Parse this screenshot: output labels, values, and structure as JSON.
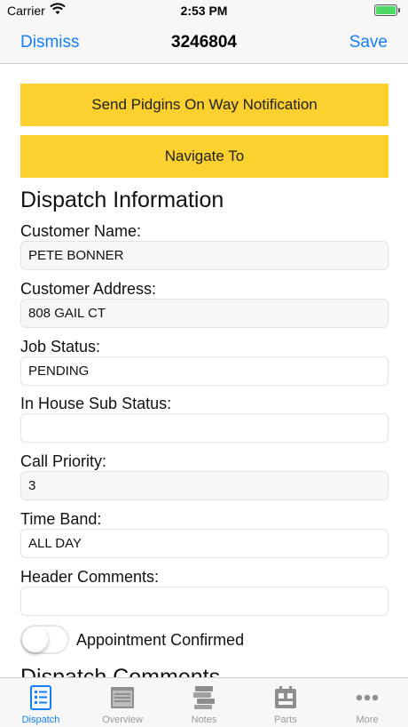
{
  "status_bar": {
    "carrier": "Carrier",
    "time": "2:53 PM",
    "battery_level": 1.0
  },
  "nav": {
    "dismiss_label": "Dismiss",
    "title": "3246804",
    "save_label": "Save"
  },
  "actions": {
    "send_notification_label": "Send Pidgins On Way Notification",
    "navigate_label": "Navigate To"
  },
  "dispatch_info": {
    "heading": "Dispatch Information",
    "fields": [
      {
        "label": "Customer Name:",
        "value": "PETE BONNER"
      },
      {
        "label": "Customer Address:",
        "value": "808 GAIL CT"
      },
      {
        "label": "Job Status:",
        "value": "PENDING"
      },
      {
        "label": "In House Sub Status:",
        "value": ""
      },
      {
        "label": "Call Priority:",
        "value": "3"
      },
      {
        "label": "Time Band:",
        "value": "ALL DAY"
      },
      {
        "label": "Header Comments:",
        "value": ""
      }
    ],
    "appointment_confirmed_label": "Appointment Confirmed",
    "appointment_confirmed": false
  },
  "dispatch_comments": {
    "heading": "Dispatch Comments"
  },
  "tabs": [
    {
      "label": "Dispatch",
      "icon": "list-document-icon",
      "active": true
    },
    {
      "label": "Overview",
      "icon": "overview-icon",
      "active": false
    },
    {
      "label": "Notes",
      "icon": "notes-icon",
      "active": false
    },
    {
      "label": "Parts",
      "icon": "parts-icon",
      "active": false
    },
    {
      "label": "More",
      "icon": "more-icon",
      "active": false
    }
  ],
  "colors": {
    "accent": "#147efb",
    "action_button": "#fbd02f",
    "battery": "#4cd964"
  }
}
